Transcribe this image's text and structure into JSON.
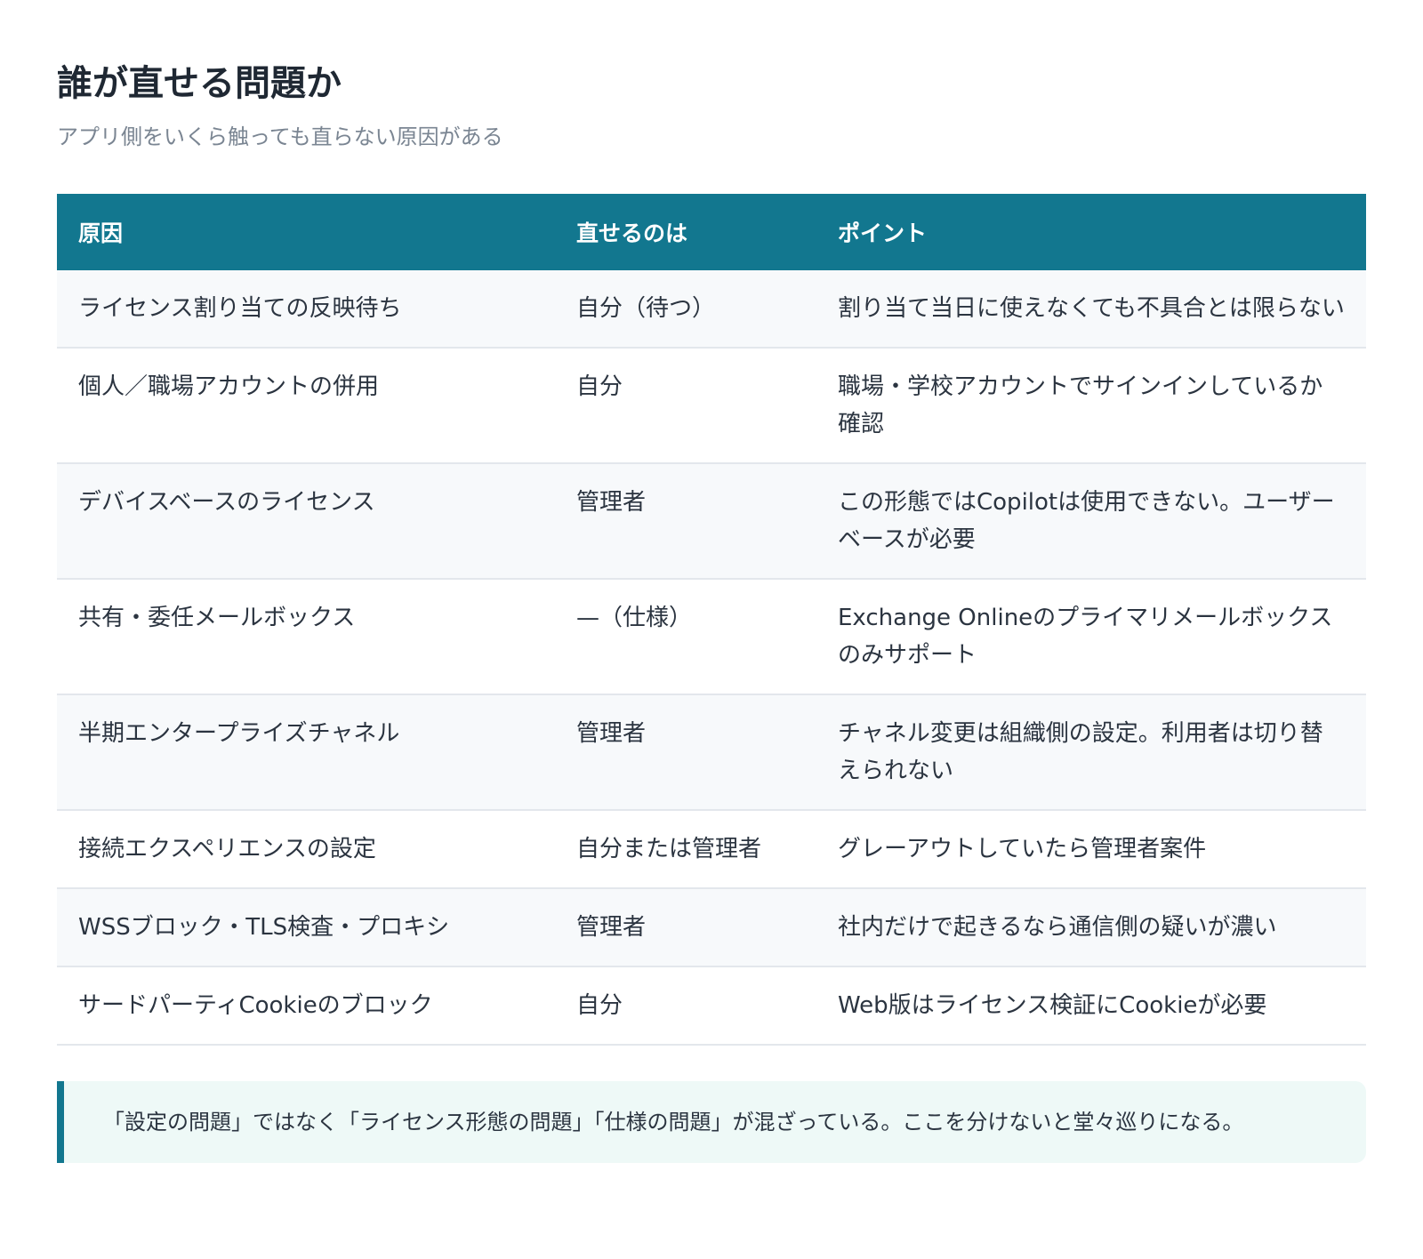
{
  "header": {
    "title": "誰が直せる問題か",
    "subtitle": "アプリ側をいくら触っても直らない原因がある"
  },
  "table": {
    "columns": [
      "原因",
      "直せるのは",
      "ポイント"
    ],
    "rows": [
      [
        "ライセンス割り当ての反映待ち",
        "自分（待つ）",
        "割り当て当日に使えなくても不具合とは限らない"
      ],
      [
        "個人／職場アカウントの併用",
        "自分",
        "職場・学校アカウントでサインインしているか確認"
      ],
      [
        "デバイスベースのライセンス",
        "管理者",
        "この形態ではCopilotは使用できない。ユーザーベースが必要"
      ],
      [
        "共有・委任メールボックス",
        "—（仕様）",
        "Exchange Onlineのプライマリメールボックスのみサポート"
      ],
      [
        "半期エンタープライズチャネル",
        "管理者",
        "チャネル変更は組織側の設定。利用者は切り替えられない"
      ],
      [
        "接続エクスペリエンスの設定",
        "自分または管理者",
        "グレーアウトしていたら管理者案件"
      ],
      [
        "WSSブロック・TLS検査・プロキシ",
        "管理者",
        "社内だけで起きるなら通信側の疑いが濃い"
      ],
      [
        "サードパーティCookieのブロック",
        "自分",
        "Web版はライセンス検証にCookieが必要"
      ]
    ]
  },
  "note": {
    "text": "「設定の問題」ではなく「ライセンス形態の問題」「仕様の問題」が混ざっている。ここを分けないと堂々巡りになる。"
  },
  "colors": {
    "header_bg": "#12778f",
    "accent": "#12778f",
    "note_bg": "#eef9f7"
  }
}
